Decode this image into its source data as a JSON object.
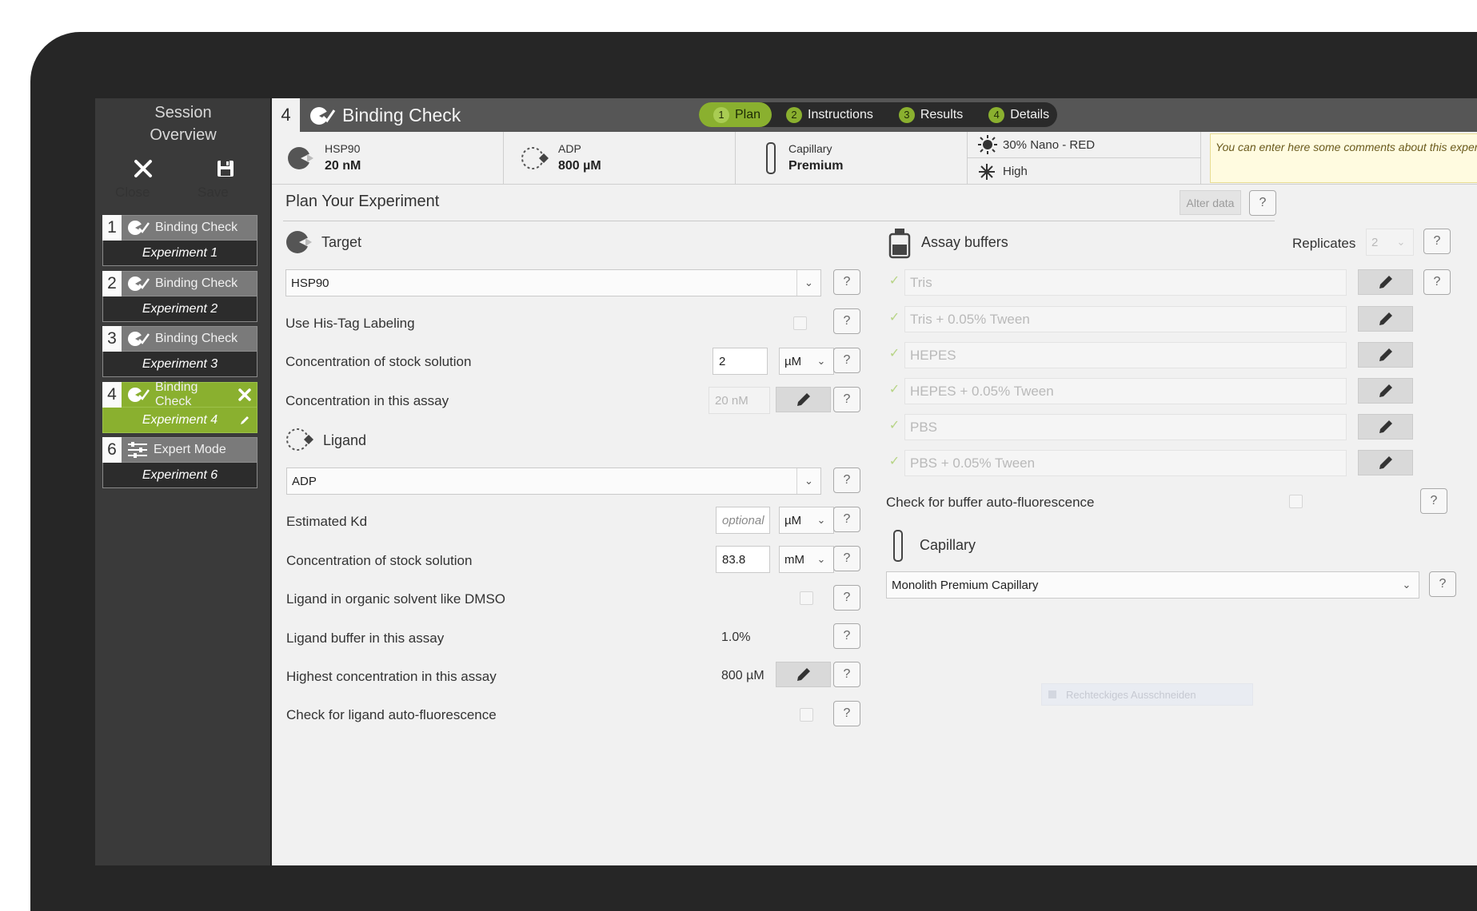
{
  "sidebar": {
    "title_line1": "Session",
    "title_line2": "Overview",
    "close_label": "Close",
    "save_label": "Save",
    "experiments": [
      {
        "num": "1",
        "title": "Binding Check",
        "name": "Experiment 1"
      },
      {
        "num": "2",
        "title": "Binding Check",
        "name": "Experiment 2"
      },
      {
        "num": "3",
        "title": "Binding Check",
        "name": "Experiment 3"
      },
      {
        "num": "4",
        "title": "Binding Check",
        "name": "Experiment 4"
      },
      {
        "num": "6",
        "title": "Expert Mode",
        "name": "Experiment 6"
      }
    ]
  },
  "header": {
    "number": "4",
    "title": "Binding Check",
    "steps": [
      {
        "num": "1",
        "label": "Plan"
      },
      {
        "num": "2",
        "label": "Instructions"
      },
      {
        "num": "3",
        "label": "Results"
      },
      {
        "num": "4",
        "label": "Details"
      }
    ]
  },
  "summary": {
    "target_name": "HSP90",
    "target_conc": "20 nM",
    "ligand_name": "ADP",
    "ligand_conc": "800 µM",
    "capillary_label": "Capillary",
    "capillary_value": "Premium",
    "led_power": "30% Nano - RED",
    "mst_power": "High",
    "comment_placeholder": "You can enter here some comments about this experiment"
  },
  "plan": {
    "title": "Plan Your Experiment",
    "alter_data": "Alter data",
    "help": "?",
    "target": {
      "section": "Target",
      "selected": "HSP90",
      "his_tag": "Use His-Tag Labeling",
      "stock_label": "Concentration of stock solution",
      "stock_value": "2",
      "stock_unit": "µM",
      "assay_label": "Concentration in this assay",
      "assay_value": "20 nM"
    },
    "ligand": {
      "section": "Ligand",
      "selected": "ADP",
      "kd_label": "Estimated Kd",
      "kd_placeholder": "optional",
      "kd_unit": "µM",
      "stock_label": "Concentration of stock solution",
      "stock_value": "83.8",
      "stock_unit": "mM",
      "dmso_label": "Ligand in organic solvent like DMSO",
      "buffer_label": "Ligand buffer in this assay",
      "buffer_value": "1.0%",
      "highest_label": "Highest concentration in this assay",
      "highest_value": "800 µM",
      "autofl_label": "Check for ligand auto-fluorescence"
    },
    "assay": {
      "section": "Assay buffers",
      "replicates_label": "Replicates",
      "replicates_value": "2",
      "buffers": [
        "Tris",
        "Tris + 0.05% Tween",
        "HEPES",
        "HEPES + 0.05% Tween",
        "PBS",
        "PBS + 0.05% Tween"
      ],
      "autofl_label": "Check for buffer auto-fluorescence"
    },
    "capillary": {
      "section": "Capillary",
      "selected": "Monolith Premium Capillary"
    }
  },
  "ghost_tooltip": "Rechteckiges Ausschneiden",
  "colors": {
    "accent": "#8ab02f",
    "sidebar": "#3a3a3a",
    "header": "#565656",
    "panel": "#f1f1f1"
  }
}
